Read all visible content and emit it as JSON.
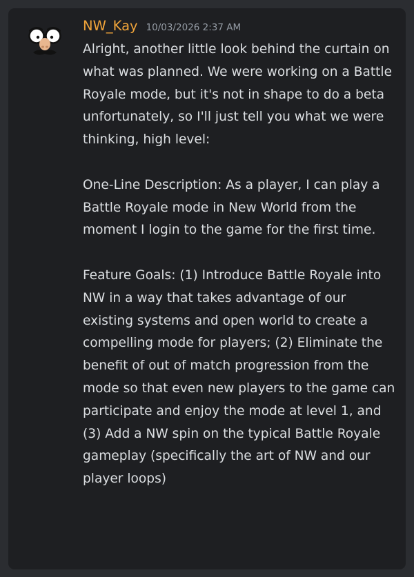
{
  "message": {
    "author": "NW_Kay",
    "timestamp": "10/03/2026 2:37 AM",
    "author_color": "#f0a43a",
    "avatar_icon": "groucho-disguise-glasses-icon",
    "paragraphs": [
      "Alright, another little look behind the curtain on what was planned. We were working on a Battle Royale mode, but it's not in shape to do a beta unfortunately, so I'll just tell you what we were thinking, high level:",
      "One-Line Description: As a player, I can play a Battle Royale mode in New World from the moment I login to the game for the first time.",
      "Feature Goals: (1) Introduce Battle Royale into NW in a way that takes advantage of our existing systems and open world to create a compelling mode for players; (2) Eliminate the benefit of out of match progression from the mode so that even new players to the game can participate and enjoy the mode at level 1, and (3) Add a NW spin on the typical Battle Royale gameplay (specifically the art of NW and our player loops)"
    ]
  }
}
